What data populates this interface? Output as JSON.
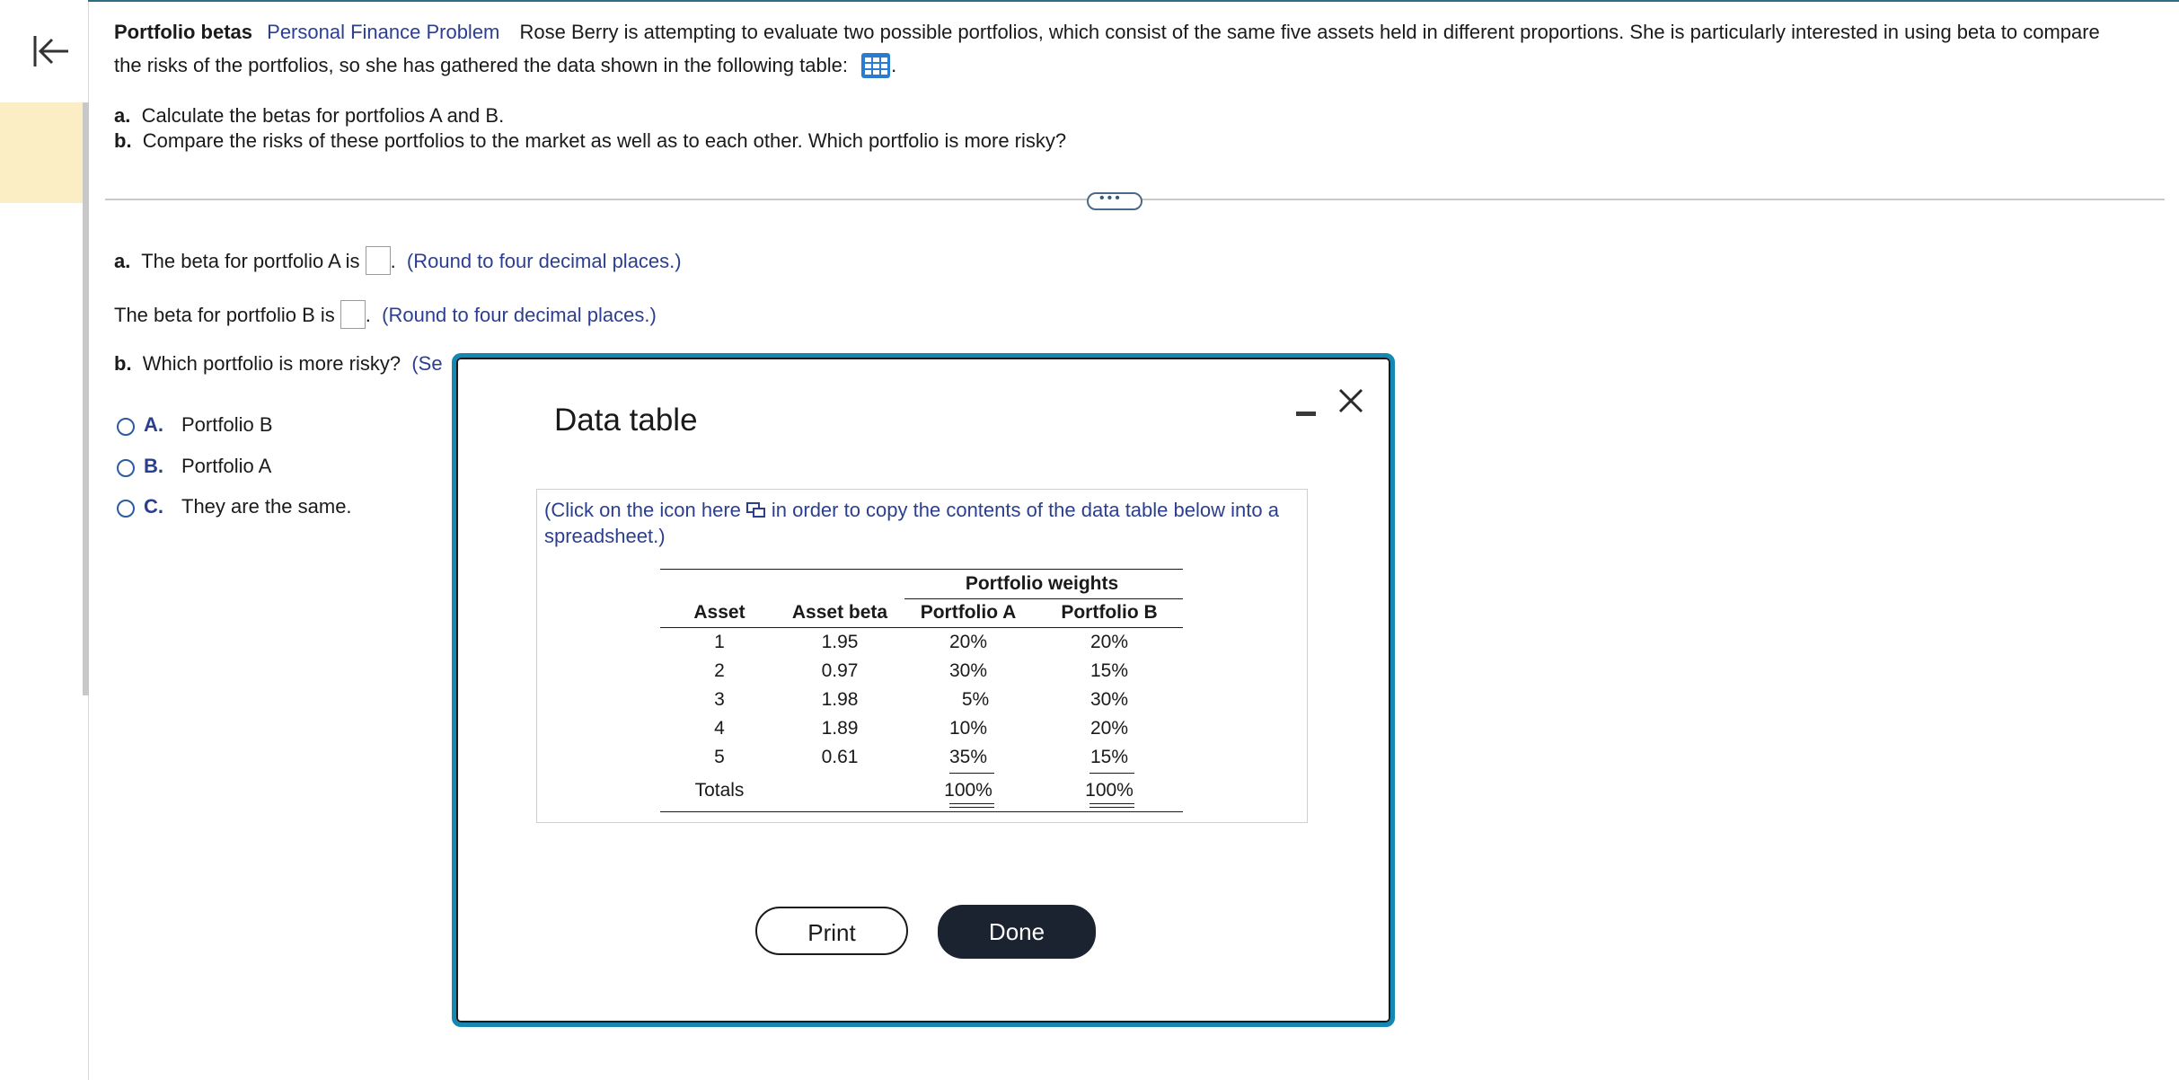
{
  "problem": {
    "title": "Portfolio betas",
    "subject": "Personal Finance Problem",
    "text": "Rose Berry is attempting to evaluate two possible portfolios, which consist of the same five assets held in different proportions.  She is particularly interested in using beta to compare the risks of the portfolios, so she has gathered the data shown in the following table:",
    "part_a_label": "a.",
    "part_a_text": "Calculate the betas for portfolios A and B.",
    "part_b_label": "b.",
    "part_b_text": "Compare the risks of these portfolios to the market as well as to each other.  Which portfolio is more risky?"
  },
  "answers": {
    "a_label": "a.",
    "a_prefix": "The beta for portfolio A is",
    "a_hint": "(Round to four decimal places.)",
    "b_prefix": "The beta for portfolio B is",
    "b_hint": "(Round to four decimal places.)",
    "q_label": "b.",
    "q_text": "Which portfolio is more risky?",
    "q_hint_visible": "(Se",
    "options": [
      {
        "letter": "A.",
        "text": "Portfolio B"
      },
      {
        "letter": "B.",
        "text": "Portfolio A"
      },
      {
        "letter": "C.",
        "text": "They are the same."
      }
    ]
  },
  "modal": {
    "title": "Data table",
    "instruction_1": "(Click on the icon here",
    "instruction_2": "in order to copy the contents of the data table below into a spreadsheet.)",
    "group_header": "Portfolio weights",
    "headers": [
      "Asset",
      "Asset beta",
      "Portfolio A",
      "Portfolio B"
    ],
    "rows": [
      [
        "1",
        "1.95",
        "20%",
        "20%"
      ],
      [
        "2",
        "0.97",
        "30%",
        "15%"
      ],
      [
        "3",
        "1.98",
        "5%",
        "30%"
      ],
      [
        "4",
        "1.89",
        "10%",
        "20%"
      ],
      [
        "5",
        "0.61",
        "35%",
        "15%"
      ]
    ],
    "totals": [
      "Totals",
      "",
      "100%",
      "100%"
    ],
    "print_label": "Print",
    "done_label": "Done"
  },
  "icons": {
    "collapse": "arrow-to-left-icon",
    "table": "table-grid-icon",
    "more": "ellipsis-icon",
    "copy": "copy-icon",
    "minimize": "minimize-icon",
    "close": "close-icon"
  },
  "colors": {
    "accent_blue": "#2c3f8f",
    "modal_border": "#1587b3",
    "rail_highlight": "#fbeec4",
    "done_button": "#1b2230"
  }
}
